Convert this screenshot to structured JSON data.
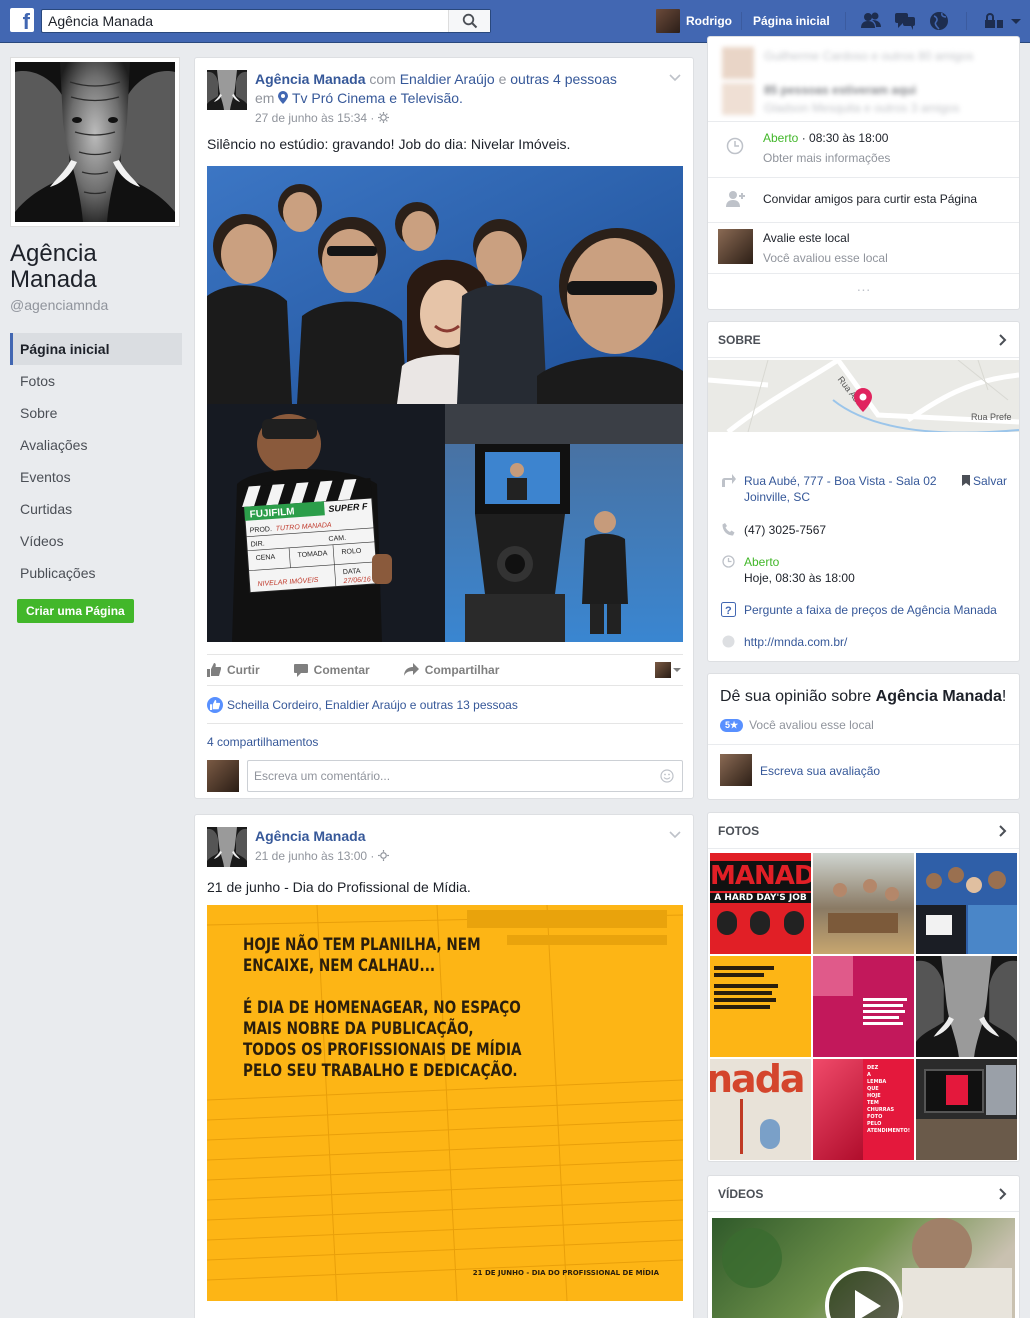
{
  "topbar": {
    "search_value": "Agência Manada",
    "user_name": "Rodrigo",
    "home_label": "Página inicial"
  },
  "page": {
    "name_line1": "Agência",
    "name_line2": "Manada",
    "handle": "@agenciamnda"
  },
  "nav": {
    "items": [
      "Página inicial",
      "Fotos",
      "Sobre",
      "Avaliações",
      "Eventos",
      "Curtidas",
      "Vídeos",
      "Publicações"
    ],
    "create_page": "Criar uma Página"
  },
  "post1": {
    "author": "Agência Manada",
    "with_word": "com",
    "tagged": "Enaldier Araújo",
    "and_word": "e",
    "others": "outras 4 pessoas",
    "at_word": "em",
    "place": "Tv Pró Cinema e Televisão.",
    "time": "27 de junho às 15:34 ·",
    "text": "Silêncio no estúdio: gravando! Job do dia: Nivelar Imóveis.",
    "like_label": "Curtir",
    "comment_label": "Comentar",
    "share_label": "Compartilhar",
    "likes_text": "Scheilla Cordeiro, Enaldier Araújo e outras 13 pessoas",
    "shares_text": "4 compartilhamentos",
    "comment_placeholder": "Escreva um comentário...",
    "clapper": {
      "brand": "FUJIFILM",
      "film": "SUPER F",
      "prod": "PROD.",
      "dir": "DIR.",
      "cam": "CAM.",
      "cena": "CENA",
      "tomada": "TOMADA",
      "rolo": "ROLO",
      "data": "DATA",
      "hand1": "TUTRO MANADA",
      "hand2": "NIVELAR IMÓVEIS",
      "hand3": "27/06/16"
    }
  },
  "post2": {
    "author": "Agência Manada",
    "time": "21 de junho às 13:00 ·",
    "text": "21 de junho - Dia do Profissional de Mídia.",
    "poster_lines": [
      "HOJE NÃO TEM PLANILHA, NEM",
      "ENCAIXE, NEM CALHAU...",
      "",
      "É DIA DE HOMENAGEAR, NO ESPAÇO",
      "MAIS NOBRE DA PUBLICAÇÃO,",
      "TODOS OS PROFISSIONAIS DE MÍDIA",
      "PELO SEU TRABALHO E DEDICAÇÃO."
    ],
    "poster_footer": "21 DE JUNHO - DIA DO PROFISSIONAL DE MÍDIA"
  },
  "right_top": {
    "friends1": "Guilherme Cardoso e outros 80 amigos",
    "friends2": "85 pessoas estiveram aqui",
    "friends3": "Gladson Mesquita e outros 3 amigos",
    "hours_status": "Aberto",
    "hours_range": " · 08:30 às 18:00",
    "more_info": "Obter mais informações",
    "invite": "Convidar amigos para curtir esta Página",
    "rate_title": "Avalie este local",
    "rate_sub": "Você avaliou esse local",
    "dots": "···"
  },
  "about": {
    "title": "SOBRE",
    "map_street1": "Rua Aubé",
    "map_street2": "Rua Prefe",
    "address1": "Rua Aubé, 777 - Boa Vista - Sala 02",
    "address2": "Joinville, SC",
    "save": "Salvar",
    "phone": "(47) 3025-7567",
    "open": "Aberto",
    "today": "Hoje, 08:30 às 18:00",
    "price_q": "Pergunte a faixa de preços de Agência Manada",
    "website": "http://mnda.com.br/"
  },
  "review": {
    "title_prefix": "Dê sua opinião sobre ",
    "title_bold": "Agência Manada",
    "title_suffix": "!",
    "star": "5★",
    "rated": "Você avaliou esse local",
    "write": "Escreva sua avaliação"
  },
  "photos": {
    "title": "FOTOS",
    "t1_a": "MANADA",
    "t1_b": "A HARD DAY'S JOB",
    "t7": "nada",
    "t8_lines": [
      "DEZ",
      "A",
      "LEMBA",
      "QUE",
      "HOJE",
      "TEM",
      "CHURRAS",
      "FOTO",
      "PELO",
      "ATENDIMENTO!"
    ]
  },
  "videos": {
    "title": "VÍDEOS"
  },
  "colors": {
    "fb_blue": "#4267b2",
    "link": "#365899",
    "green": "#42b72a",
    "poster_yellow": "#fdb515",
    "studio_blue": "#2a5ca8"
  }
}
